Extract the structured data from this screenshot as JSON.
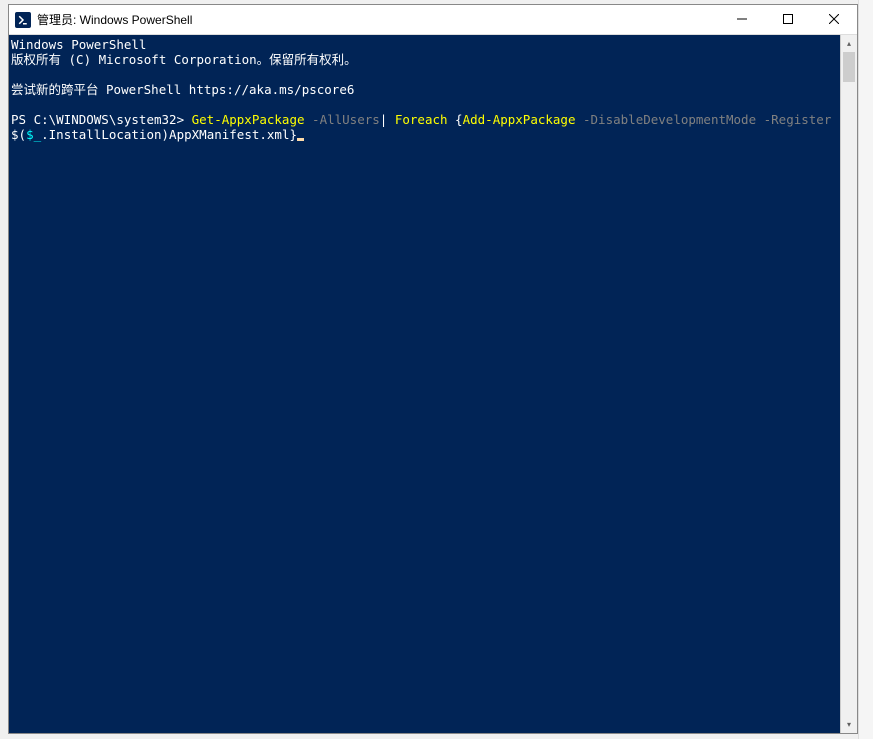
{
  "window": {
    "title": "管理员: Windows PowerShell"
  },
  "terminal": {
    "line1": "Windows PowerShell",
    "line2": "版权所有 (C) Microsoft Corporation。保留所有权利。",
    "line3": "",
    "line4": "尝试新的跨平台 PowerShell https://aka.ms/pscore6",
    "line5": "",
    "prompt": "PS C:\\WINDOWS\\system32> ",
    "cmd_seg1": "Get-AppxPackage",
    "cmd_seg2": " -AllUsers",
    "cmd_seg3": "| ",
    "cmd_seg4": "Foreach",
    "cmd_seg5": " {",
    "cmd_seg6": "Add-AppxPackage",
    "cmd_seg7": " -DisableDevelopmentMode -Register ",
    "cmd_seg8": "$(",
    "cmd_seg9": "$_",
    "cmd_seg10": ".InstallLocation)AppXManifest.xml",
    "cmd_seg11": "}"
  }
}
